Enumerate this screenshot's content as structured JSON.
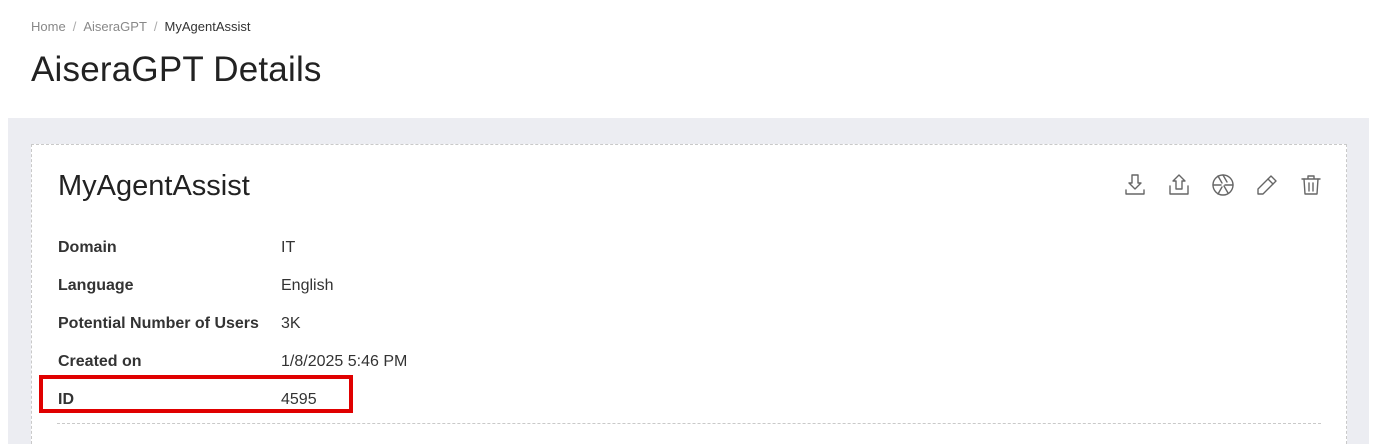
{
  "breadcrumb": {
    "items": [
      "Home",
      "AiseraGPT",
      "MyAgentAssist"
    ],
    "separator": "/"
  },
  "page": {
    "title": "AiseraGPT Details"
  },
  "card": {
    "title": "MyAgentAssist",
    "actions": [
      {
        "name": "download-icon"
      },
      {
        "name": "upload-icon"
      },
      {
        "name": "aperture-icon"
      },
      {
        "name": "edit-icon"
      },
      {
        "name": "delete-icon"
      }
    ],
    "details": [
      {
        "label": "Domain",
        "value": "IT"
      },
      {
        "label": "Language",
        "value": "English"
      },
      {
        "label": "Potential Number of Users",
        "value": "3K"
      },
      {
        "label": "Created on",
        "value": "1/8/2025 5:46 PM"
      },
      {
        "label": "ID",
        "value": "4595"
      }
    ]
  },
  "colors": {
    "background_band": "#ecedf2",
    "highlight": "#e00000"
  }
}
